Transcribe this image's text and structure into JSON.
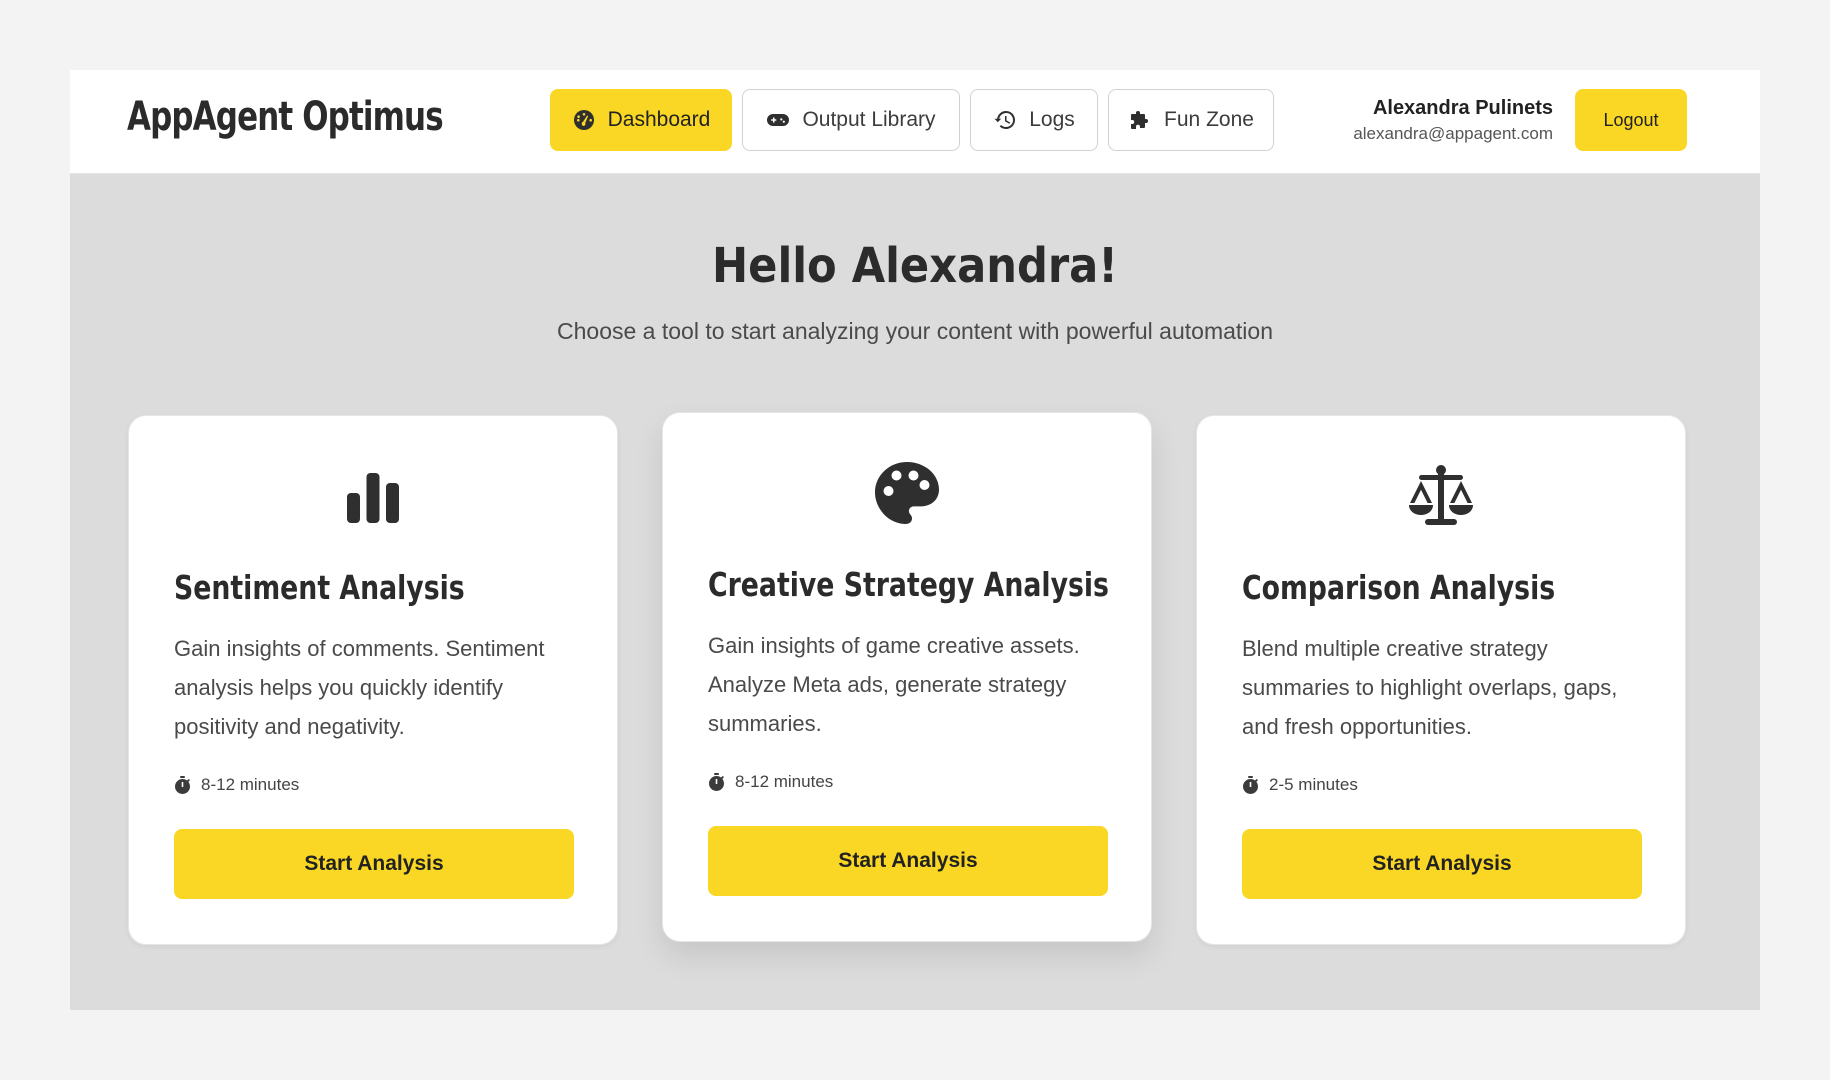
{
  "header": {
    "brand": "AppAgent Optimus",
    "nav": [
      {
        "label": "Dashboard",
        "icon": "gauge-icon",
        "active": true
      },
      {
        "label": "Output Library",
        "icon": "gamepad-icon",
        "active": false
      },
      {
        "label": "Logs",
        "icon": "history-icon",
        "active": false
      },
      {
        "label": "Fun Zone",
        "icon": "puzzle-icon",
        "active": false
      }
    ],
    "user": {
      "name": "Alexandra Pulinets",
      "email": "alexandra@appagent.com"
    },
    "logout_label": "Logout"
  },
  "hero": {
    "title": "Hello Alexandra!",
    "subtitle": "Choose a tool to start analyzing your content with powerful automation"
  },
  "cards": [
    {
      "icon": "bar-chart-icon",
      "title": "Sentiment Analysis",
      "description": "Gain insights of comments. Sentiment analysis helps you quickly identify positivity and negativity.",
      "time": "8-12 minutes",
      "button": "Start Analysis"
    },
    {
      "icon": "palette-icon",
      "title": "Creative Strategy Analysis",
      "description": "Gain insights of game creative assets. Analyze Meta ads, generate strategy summaries.",
      "time": "8-12 minutes",
      "button": "Start Analysis"
    },
    {
      "icon": "scale-balance-icon",
      "title": "Comparison Analysis",
      "description": "Blend multiple creative strategy summaries to highlight overlaps, gaps, and fresh opportunities.",
      "time": "2-5 minutes",
      "button": "Start Analysis"
    }
  ],
  "colors": {
    "accent": "#f9d724",
    "background": "#dcdcdc",
    "card": "#ffffff",
    "text": "#2b2b2b"
  }
}
